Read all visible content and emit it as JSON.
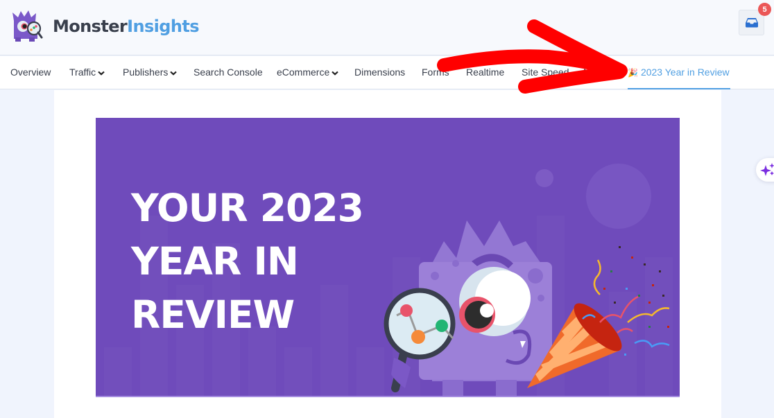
{
  "header": {
    "brand_part1": "Monster",
    "brand_part2": "Insights",
    "notifications_count": "5"
  },
  "nav": {
    "items": [
      {
        "label": "Overview",
        "dropdown": false
      },
      {
        "label": "Traffic",
        "dropdown": true
      },
      {
        "label": "Publishers",
        "dropdown": true
      },
      {
        "label": "Search Console",
        "dropdown": false
      },
      {
        "label": "eCommerce",
        "dropdown": true
      },
      {
        "label": "Dimensions",
        "dropdown": false
      },
      {
        "label": "Forms",
        "dropdown": false
      },
      {
        "label": "Realtime",
        "dropdown": false
      },
      {
        "label": "Site Speed",
        "dropdown": false
      },
      {
        "label": "M",
        "dropdown": false
      },
      {
        "label": "2023 Year in Review",
        "dropdown": false,
        "active": true,
        "icon": "party-popper-icon"
      }
    ]
  },
  "banner": {
    "title_line1": "YOUR 2023",
    "title_line2": "YEAR IN",
    "title_line3": "REVIEW"
  },
  "colors": {
    "accent": "#509fe2",
    "banner_bg": "#6f4bbb",
    "badge": "#eb5757",
    "annotation_arrow": "#ff0000"
  }
}
